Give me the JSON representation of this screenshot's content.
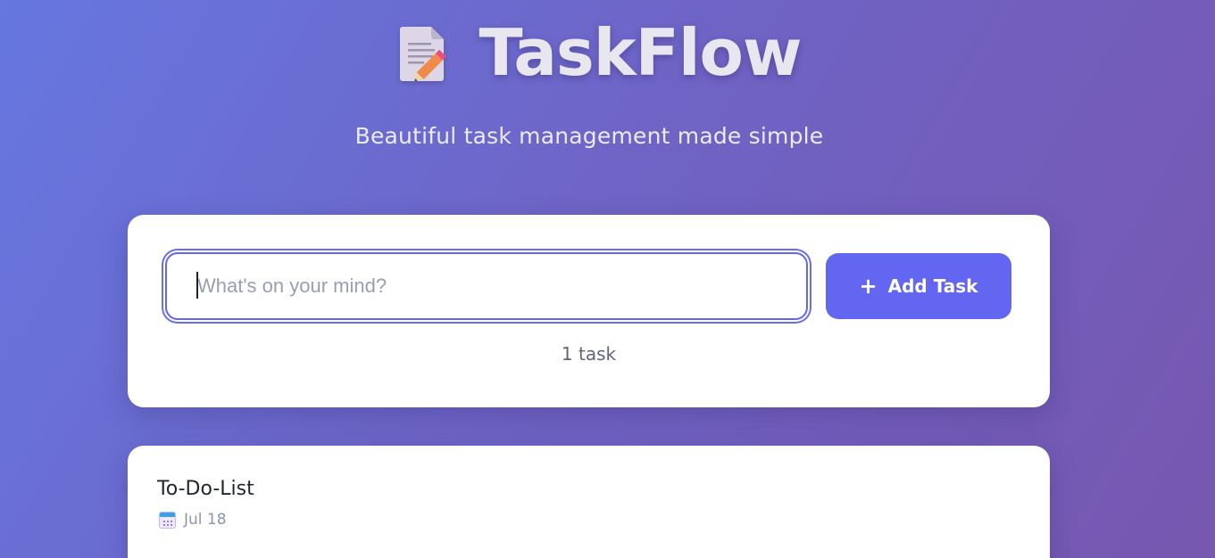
{
  "header": {
    "logo_icon": "memo-pencil-icon",
    "title": "TaskFlow",
    "subtitle": "Beautiful task management made simple"
  },
  "composer": {
    "placeholder": "What's on your mind?",
    "value": "",
    "add_button_icon": "+",
    "add_button_label": "Add Task",
    "task_count": "1 task"
  },
  "tasks": [
    {
      "title": "To-Do-List",
      "date_icon": "calendar-icon",
      "date": "Jul 18"
    }
  ],
  "colors": {
    "accent": "#6366f1",
    "background_start": "#6677e0",
    "background_end": "#7757b0",
    "card": "#ffffff"
  }
}
